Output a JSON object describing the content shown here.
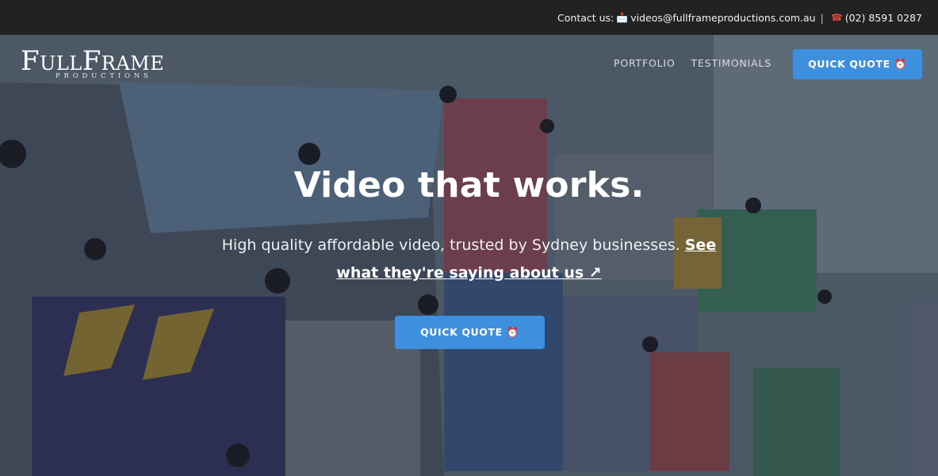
{
  "topbar": {
    "contact_label": "Contact us:",
    "email_icon": "inbox-tray-icon",
    "email": "videos@fullframeproductions.com.au",
    "separator": "|",
    "phone_icon": "telephone-icon",
    "phone": "(02) 8591 0287"
  },
  "logo": {
    "main": "FullFrame",
    "sub": "PRODUCTIONS"
  },
  "nav": {
    "portfolio": "PORTFOLIO",
    "testimonials": "TESTIMONIALS",
    "quick_quote": "QUICK QUOTE ⏰"
  },
  "hero": {
    "headline": "Video that works.",
    "subline": "High quality affordable video, trusted by Sydney businesses.",
    "sub_link": "See what they're saying about us ↗",
    "cta": "QUICK QUOTE ⏰"
  },
  "colors": {
    "accent": "#3f8fdf",
    "topbar": "#222222"
  }
}
